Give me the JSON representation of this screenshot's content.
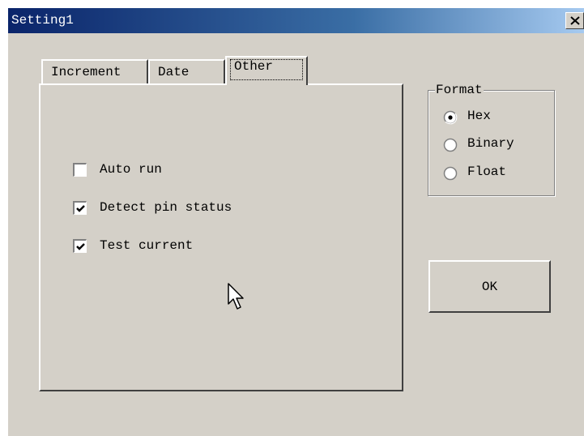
{
  "window": {
    "title": "Setting1"
  },
  "tabs": [
    {
      "label": "Increment",
      "active": false
    },
    {
      "label": "Date",
      "active": false
    },
    {
      "label": "Other",
      "active": true
    }
  ],
  "options": [
    {
      "label": "Auto run",
      "checked": false
    },
    {
      "label": "Detect pin status",
      "checked": true
    },
    {
      "label": "Test current",
      "checked": true
    }
  ],
  "format": {
    "title": "Format",
    "options": [
      {
        "label": "Hex",
        "selected": true
      },
      {
        "label": "Binary",
        "selected": false
      },
      {
        "label": "Float",
        "selected": false
      }
    ]
  },
  "buttons": {
    "ok_label": "OK"
  },
  "colors": {
    "face": "#d4d0c8",
    "title_start": "#0a246a",
    "title_end": "#a6caf0"
  }
}
